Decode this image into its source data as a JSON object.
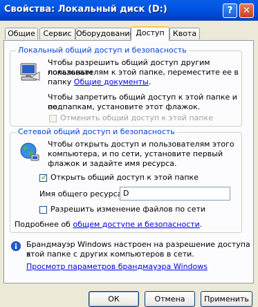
{
  "window": {
    "title": "Свойства: Локальный диск (D:)",
    "help_label": "?",
    "close_label": "✕"
  },
  "tabs": [
    {
      "label": "Общие"
    },
    {
      "label": "Сервис"
    },
    {
      "label": "Оборудование"
    },
    {
      "label": "Доступ",
      "active": true
    },
    {
      "label": "Квота"
    }
  ],
  "local_group": {
    "title": "Локальный общий доступ и безопасность",
    "para1_line1": "Чтобы разрешить общий доступ другим локальным",
    "para1_line2": "пользователям к этой папке, переместите ее в",
    "para1_line3_prefix": "папку ",
    "shared_docs_link": "Общие документы",
    "para1_line3_suffix": ".",
    "para2_line1": "Чтобы запретить общий доступ к этой папке и ее",
    "para2_line2": "подпапкам, установите этот флажок.",
    "make_private_label": "Отменить общий доступ к этой папке",
    "make_private_checked": false,
    "make_private_enabled": false
  },
  "network_group": {
    "title": "Сетевой общий доступ и безопасность",
    "para_line1": "Чтобы открыть доступ и пользователям этого",
    "para_line2": "компьютера, и по сети, установите первый",
    "para_line3": "флажок и задайте имя ресурса.",
    "share_label": "Открыть общий доступ к этой папке",
    "share_checked": true,
    "share_name_label": "Имя общего ресурса:",
    "share_name_value": "D",
    "allow_change_label": "Разрешить изменение файлов по сети",
    "allow_change_checked": false,
    "more_prefix": "Подробнее об ",
    "more_link": "общем доступе и безопасности",
    "more_suffix": "."
  },
  "firewall": {
    "line1": "Брандмауэр Windows настроен на разрешение доступа к",
    "line2": "этой папке с других компьютеров в сети.",
    "settings_link": "Просмотр параметров брандмауэра Windows"
  },
  "buttons": {
    "ok": "ОК",
    "cancel": "Отмена",
    "apply": "Применить"
  },
  "colors": {
    "title_bar": "#0055e5",
    "group_title": "#0046d5",
    "link": "#0000ee",
    "active_tab_accent": "#ffc83c"
  }
}
